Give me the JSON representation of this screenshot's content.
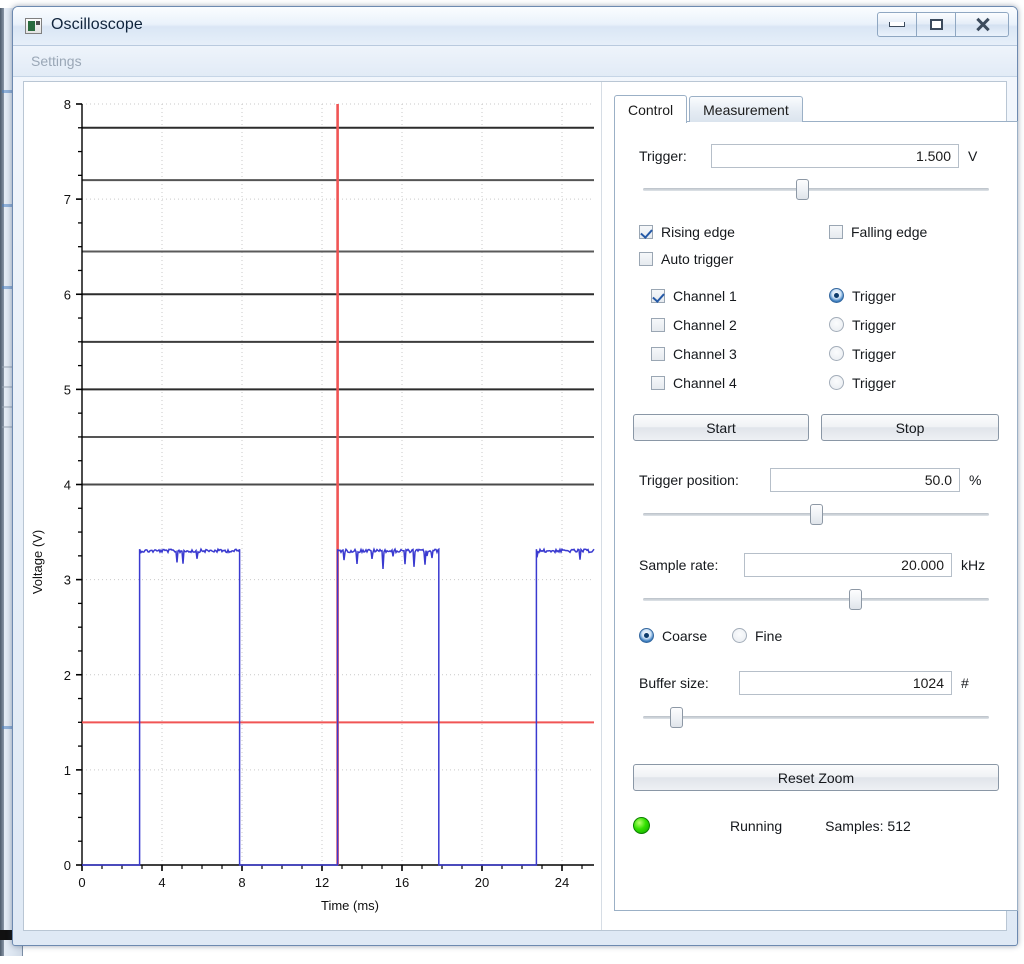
{
  "window": {
    "title": "Oscilloscope",
    "icon": "app-icon",
    "minimize_label": "–",
    "maximize_label": "□",
    "close_label": "✕"
  },
  "menubar": {
    "settings_label": "Settings"
  },
  "tabs": [
    {
      "label": "Control",
      "active": true
    },
    {
      "label": "Measurement",
      "active": false
    }
  ],
  "control": {
    "trigger": {
      "label": "Trigger:",
      "value": "1.500",
      "unit": "V",
      "slider_percent": 46
    },
    "edge": {
      "rising_label": "Rising edge",
      "rising_checked": true,
      "falling_label": "Falling edge",
      "falling_checked": false,
      "auto_label": "Auto trigger",
      "auto_checked": false
    },
    "channels": [
      {
        "label": "Channel 1",
        "checked": true,
        "trigger_label": "Trigger",
        "trigger_selected": true
      },
      {
        "label": "Channel 2",
        "checked": false,
        "trigger_label": "Trigger",
        "trigger_selected": false
      },
      {
        "label": "Channel 3",
        "checked": false,
        "trigger_label": "Trigger",
        "trigger_selected": false
      },
      {
        "label": "Channel 4",
        "checked": false,
        "trigger_label": "Trigger",
        "trigger_selected": false
      }
    ],
    "start_label": "Start",
    "stop_label": "Stop",
    "trigger_position": {
      "label": "Trigger position:",
      "value": "50.0",
      "unit": "%",
      "slider_percent": 50
    },
    "sample_rate": {
      "label": "Sample rate:",
      "value": "20.000",
      "unit": "kHz",
      "slider_percent": 62
    },
    "granularity": {
      "coarse_label": "Coarse",
      "coarse_selected": true,
      "fine_label": "Fine",
      "fine_selected": false
    },
    "buffer_size": {
      "label": "Buffer size:",
      "value": "1024",
      "unit": "#",
      "slider_percent": 8
    },
    "reset_zoom_label": "Reset Zoom",
    "status": {
      "led_color": "#2fd400",
      "state_label": "Running",
      "samples_label": "Samples: 512"
    }
  },
  "chart_data": {
    "type": "line",
    "title": "",
    "xlabel": "Time (ms)",
    "ylabel": "Voltage (V)",
    "xlim": [
      0,
      25.6
    ],
    "ylim": [
      0,
      8
    ],
    "xticks": [
      0,
      4,
      8,
      12,
      16,
      20,
      24
    ],
    "yticks": [
      0,
      1,
      2,
      3,
      4,
      5,
      6,
      7,
      8
    ],
    "grid": true,
    "minor_ticks": true,
    "series": [
      {
        "name": "Channel 1",
        "color": "#3a3ad0",
        "type": "square-wave",
        "low_level": 0.0,
        "high_level": 3.32,
        "noise": 0.05,
        "edges": [
          {
            "t": 2.88,
            "to": "high"
          },
          {
            "t": 7.88,
            "to": "low"
          },
          {
            "t": 12.78,
            "to": "high"
          },
          {
            "t": 17.84,
            "to": "low"
          },
          {
            "t": 22.72,
            "to": "high"
          }
        ]
      }
    ],
    "markers": {
      "trigger_level": {
        "value": 1.5,
        "color": "#f05555",
        "orientation": "horizontal"
      },
      "trigger_time": {
        "value": 12.78,
        "color": "#f05555",
        "orientation": "vertical"
      }
    },
    "reference_lines": [
      {
        "value": 7.75,
        "color": "#2c2c2c"
      },
      {
        "value": 7.2,
        "color": "#555555"
      },
      {
        "value": 6.45,
        "color": "#5a5a5a"
      },
      {
        "value": 6.0,
        "color": "#2c2c2c"
      },
      {
        "value": 5.5,
        "color": "#3d3d3d"
      },
      {
        "value": 5.0,
        "color": "#2c2c2c"
      },
      {
        "value": 4.5,
        "color": "#555555"
      },
      {
        "value": 4.0,
        "color": "#4a4a4a"
      }
    ]
  }
}
